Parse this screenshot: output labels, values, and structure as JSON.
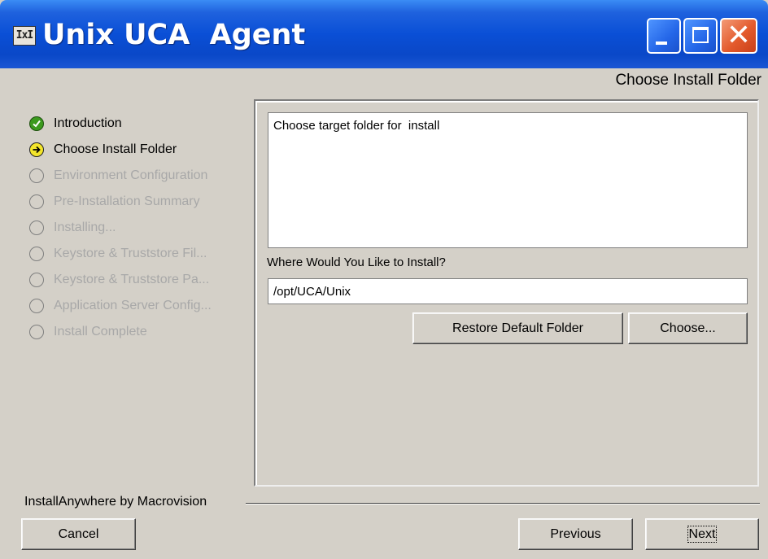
{
  "window": {
    "title": "Unix UCA  Agent",
    "app_icon_label": "IxI",
    "close_glyph": "✕"
  },
  "step_heading": "Choose Install Folder",
  "steps": [
    {
      "label": "Introduction",
      "state": "done"
    },
    {
      "label": "Choose Install Folder",
      "state": "current"
    },
    {
      "label": "Environment Configuration",
      "state": "pending"
    },
    {
      "label": "Pre-Installation Summary",
      "state": "pending"
    },
    {
      "label": "Installing...",
      "state": "pending"
    },
    {
      "label": "Keystore & Truststore Fil...",
      "state": "pending"
    },
    {
      "label": "Keystore & Truststore Pa...",
      "state": "pending"
    },
    {
      "label": "Application Server  Config...",
      "state": "pending"
    },
    {
      "label": "Install Complete",
      "state": "pending"
    }
  ],
  "main": {
    "description": "Choose target folder for  install",
    "path_label": "Where Would You Like to Install?",
    "path_value": "/opt/UCA/Unix",
    "restore_button": "Restore Default Folder",
    "choose_button": "Choose..."
  },
  "footer": {
    "brand": "InstallAnywhere by Macrovision",
    "cancel_button": "Cancel",
    "previous_button": "Previous",
    "next_button": "Next"
  },
  "colors": {
    "titlebar": "#0a4fd6",
    "window_bg": "#d4d0c8",
    "done_icon": "#3c9a1e",
    "current_icon": "#f3e52a",
    "pending_text": "#a8a8a8"
  }
}
